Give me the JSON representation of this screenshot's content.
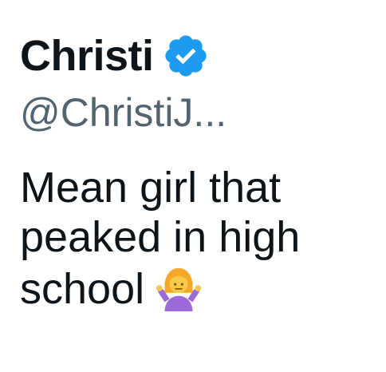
{
  "profile": {
    "display_name": "Christi",
    "verified": true,
    "badge_icon": "verified-badge-icon",
    "badge_color": "#1d9bf0",
    "handle": "@ChristiJ..."
  },
  "bio": {
    "lines": [
      "Mean girl that",
      "peaked in high",
      "school"
    ],
    "emoji_icon": "person-shrugging-emoji"
  }
}
